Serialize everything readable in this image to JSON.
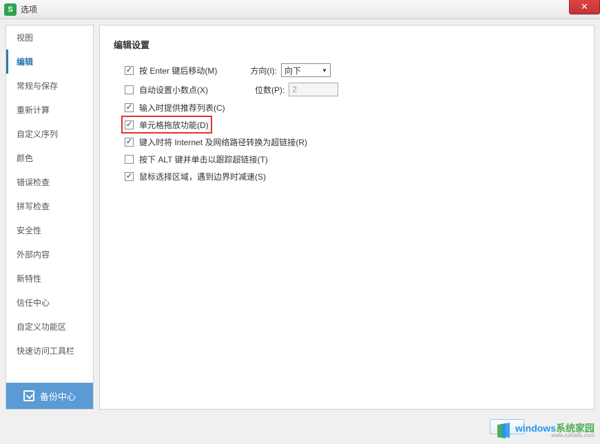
{
  "titlebar": {
    "appIcon": "S",
    "title": "选项"
  },
  "sidebar": {
    "items": [
      {
        "label": "视图"
      },
      {
        "label": "编辑"
      },
      {
        "label": "常规与保存"
      },
      {
        "label": "重新计算"
      },
      {
        "label": "自定义序列"
      },
      {
        "label": "颜色"
      },
      {
        "label": "错误检查"
      },
      {
        "label": "拼写检查"
      },
      {
        "label": "安全性"
      },
      {
        "label": "外部内容"
      },
      {
        "label": "新特性"
      },
      {
        "label": "信任中心"
      },
      {
        "label": "自定义功能区"
      },
      {
        "label": "快速访问工具栏"
      }
    ],
    "activeIndex": 1,
    "backupLabel": "备份中心"
  },
  "panel": {
    "title": "编辑设置",
    "options": [
      {
        "checked": true,
        "label": "按 Enter 键后移动(M)",
        "hasDirection": true
      },
      {
        "checked": false,
        "label": "自动设置小数点(X)",
        "hasDigits": true
      },
      {
        "checked": true,
        "label": "输入时提供推荐列表(C)"
      },
      {
        "checked": true,
        "label": "单元格拖放功能(D)",
        "highlighted": true
      },
      {
        "checked": true,
        "label": "键入时将 Internet 及网络路径转换为超链接(R)"
      },
      {
        "checked": false,
        "label": "按下 ALT 键并单击以跟踪超链接(T)"
      },
      {
        "checked": true,
        "label": "鼠标选择区域，遇到边界时减速(S)"
      }
    ],
    "directionLabel": "方向(I):",
    "directionValue": "向下",
    "digitsLabel": "位数(P):",
    "digitsValue": "2"
  },
  "watermark": {
    "textBlue": "windows",
    "textGreen": "系统家园",
    "sub": "www.ruihaifu.com"
  }
}
